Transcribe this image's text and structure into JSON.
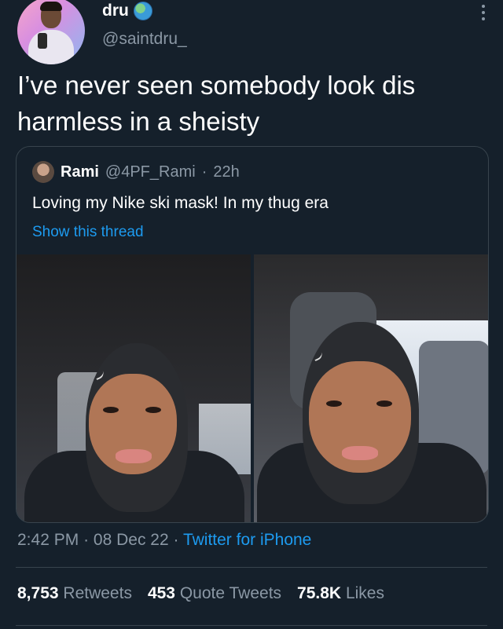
{
  "author": {
    "display_name": "dru",
    "handle": "@saintdru_",
    "verified_icon": "globe-icon"
  },
  "tweet": {
    "text": "I’ve never seen somebody look dis harmless in a sheisty"
  },
  "quote": {
    "display_name": "Rami",
    "handle": "@4PF_Rami",
    "separator": "·",
    "time": "22h",
    "text": "Loving my Nike ski mask! In my thug era",
    "thread_link": "Show this thread"
  },
  "meta": {
    "time": "2:42 PM",
    "separator": "·",
    "date": "08 Dec 22",
    "source": "Twitter for iPhone"
  },
  "stats": {
    "retweets_count": "8,753",
    "retweets_label": "Retweets",
    "quotes_count": "453",
    "quotes_label": "Quote Tweets",
    "likes_count": "75.8K",
    "likes_label": "Likes"
  },
  "colors": {
    "background": "#15202b",
    "link": "#1d9bf0",
    "secondary_text": "#8b98a5",
    "border": "#38444d"
  }
}
